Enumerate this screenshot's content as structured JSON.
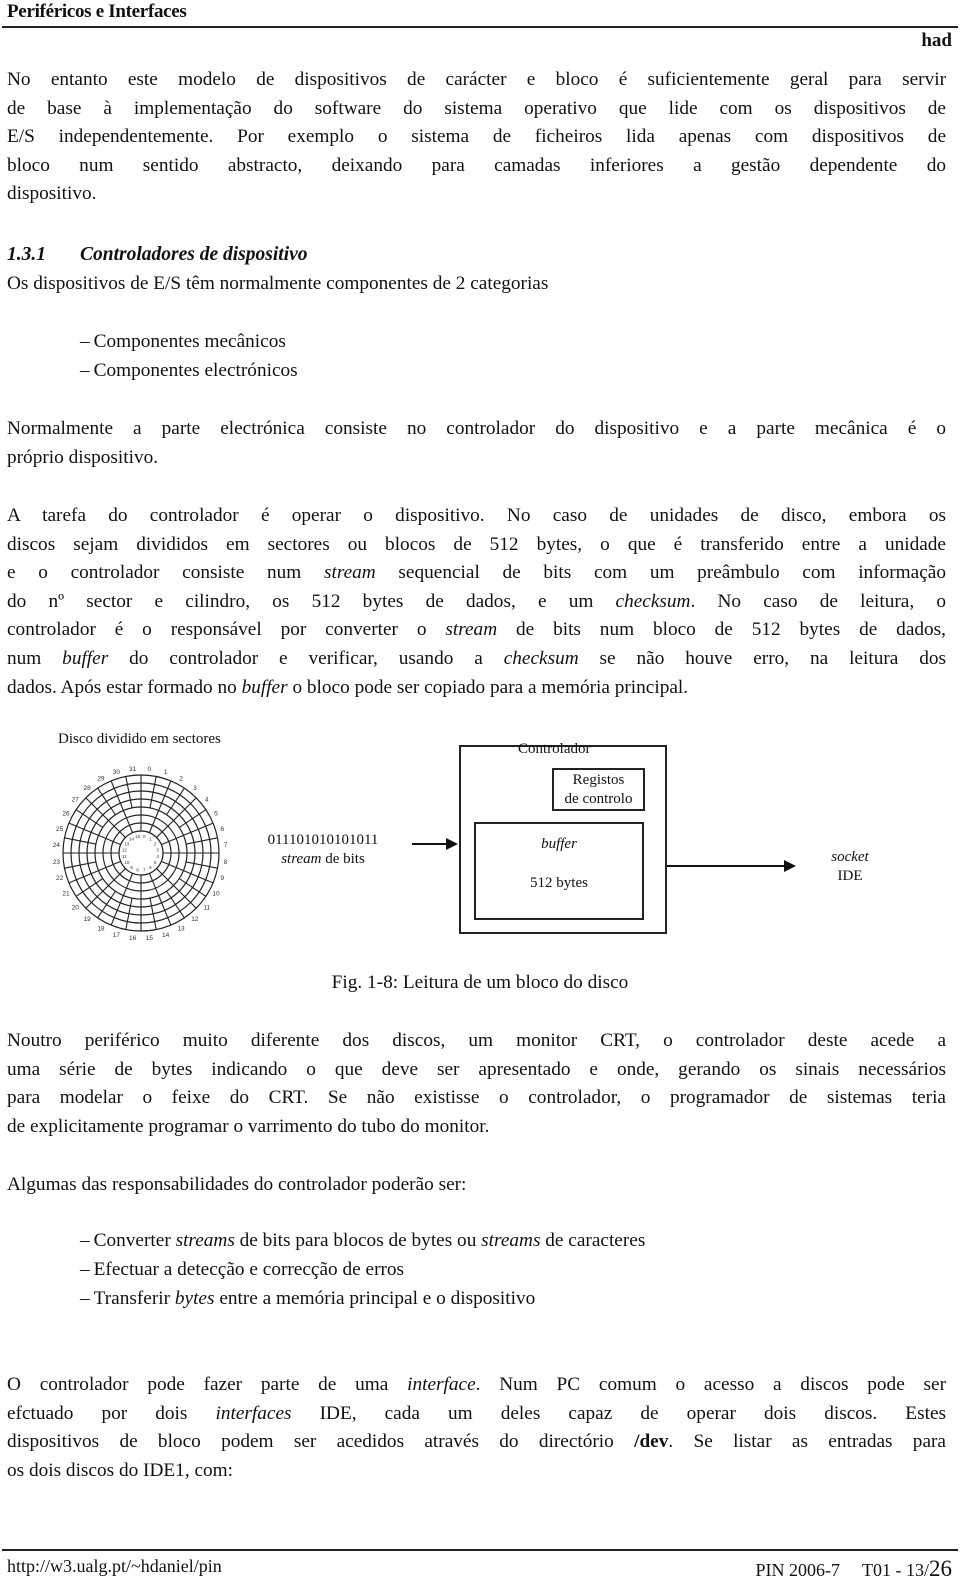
{
  "header": {
    "title": "Periféricos e Interfaces",
    "right_label": "had"
  },
  "intro_paragraph": {
    "lines": [
      "No entanto este modelo de dispositivos de carácter e bloco é suficientemente geral para servir",
      "de base à implementação do software do sistema operativo que lide com os dispositivos de",
      "E/S independentemente. Por exemplo o sistema de ficheiros lida apenas com dispositivos de",
      "bloco num sentido abstracto, deixando para camadas inferiores a gestão dependente do",
      "dispositivo."
    ]
  },
  "section": {
    "number": "1.3.1",
    "title": "Controladores de dispositivo",
    "intro": "Os dispositivos de E/S têm normalmente componentes de 2 categorias",
    "components": [
      "Componentes mecânicos",
      "Componentes electrónicos"
    ],
    "dash": "–"
  },
  "paragraph_normalmente": {
    "lines": [
      "Normalmente a parte electrónica consiste no controlador do dispositivo e a parte mecânica é o",
      "próprio dispositivo."
    ]
  },
  "paragraph_tarefa": {
    "l1": "A tarefa do controlador é operar o dispositivo. No caso de unidades de disco, embora os",
    "l2": "discos sejam divididos em sectores ou blocos de 512 bytes, o que é transferido entre a unidade",
    "l3a": "e o controlador consiste num ",
    "l3i": "stream",
    "l3b": " sequencial de bits com um preâmbulo com informação",
    "l4a": "do nº sector e cilindro, os 512 bytes de dados, e um ",
    "l4i": "checksum",
    "l4b": ". No caso de leitura, o",
    "l5a": "controlador é o responsável por converter o ",
    "l5i": "stream",
    "l5b": " de bits num bloco de 512 bytes de dados,",
    "l6a": "num ",
    "l6i1": "buffer",
    "l6b": " do controlador e verificar, usando a ",
    "l6i2": "checksum",
    "l6c": " se não houve erro, na leitura dos",
    "l7a": "dados. Após estar formado no ",
    "l7i": "buffer",
    "l7b": " o bloco pode ser copiado para a memória principal."
  },
  "figure": {
    "disk_label": "Disco dividido em sectores",
    "disk_outer_sector_count": 32,
    "disk_inner_sector_count": 16,
    "bit_stream": "011101010101011",
    "stream_label_italic": "stream",
    "stream_label_rest": " de bits",
    "controller_label": "Controlador",
    "registers_label_line1": "Registos",
    "registers_label_line2": "de controlo",
    "buffer_label": "buffer",
    "buffer_size": "512 bytes",
    "socket_label": "socket",
    "socket_type": "IDE",
    "caption": "Fig. 1-8: Leitura de um bloco do disco"
  },
  "paragraph_crt": {
    "lines": [
      "Noutro periférico muito diferente dos discos, um monitor CRT, o controlador deste acede a",
      "uma série de bytes indicando o que deve ser apresentado e onde, gerando os sinais necessários",
      "para modelar o feixe do CRT. Se não existisse o controlador, o programador de sistemas teria",
      "de explicitamente programar o varrimento do tubo do monitor."
    ]
  },
  "responsibilities": {
    "intro": "Algumas das responsabilidades do controlador poderão ser:",
    "item1": {
      "a": "Converter ",
      "i1": "streams",
      "b": " de bits para blocos de bytes ou ",
      "i2": "streams",
      "c": " de caracteres"
    },
    "item2": "Efectuar a detecção e correcção de erros",
    "item3": {
      "a": "Transferir ",
      "i": "bytes",
      "b": " entre a memória principal e o dispositivo"
    }
  },
  "paragraph_interface": {
    "l1a": "O controlador pode fazer parte de uma ",
    "l1i": "interface",
    "l1b": ". Num PC comum o acesso a discos pode ser",
    "l2a": "efctuado por dois ",
    "l2i": "interfaces",
    "l2b": " IDE, cada um deles capaz de operar dois discos. Estes",
    "l3a": "dispositivos de bloco podem ser acedidos através do directório ",
    "l3bold": "/dev",
    "l3b": ". Se listar as entradas para",
    "l4": "os dois discos do IDE1, com:"
  },
  "footer": {
    "url": "http://w3.ualg.pt/~hdaniel/pin",
    "course": "PIN 2006-7",
    "page_prefix": "T01 - 13/",
    "page_total": "26"
  }
}
